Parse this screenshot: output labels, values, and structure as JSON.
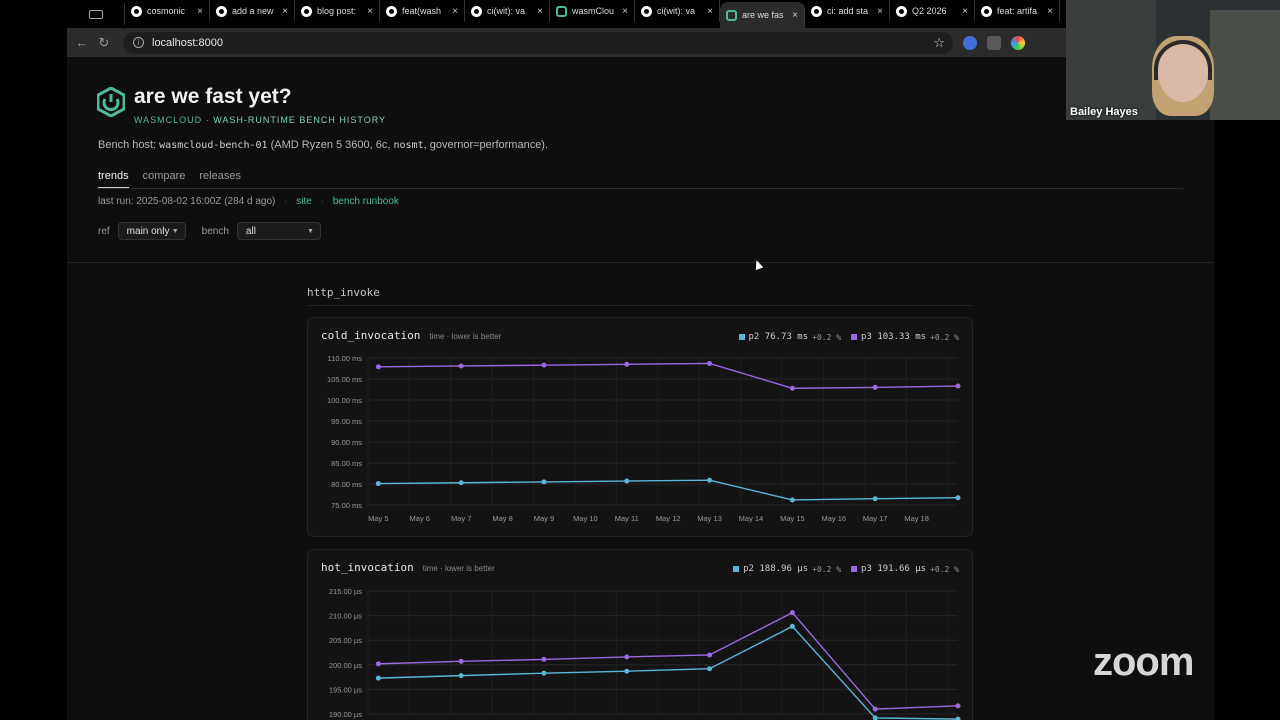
{
  "browser": {
    "tabs": [
      {
        "title": "cosmonic",
        "icon": "github-icon"
      },
      {
        "title": "add a new",
        "icon": "github-icon"
      },
      {
        "title": "blog post:",
        "icon": "github-icon"
      },
      {
        "title": "feat(wash",
        "icon": "github-icon"
      },
      {
        "title": "ci(wit): va",
        "icon": "github-icon"
      },
      {
        "title": "wasmClou",
        "icon": "wasmcloud-icon"
      },
      {
        "title": "ci(wit): va",
        "icon": "github-icon"
      },
      {
        "title": "are we fas",
        "icon": "wasmcloud-icon",
        "active": true
      },
      {
        "title": "ci: add sta",
        "icon": "github-icon"
      },
      {
        "title": "Q2 2026",
        "icon": "github-icon"
      },
      {
        "title": "feat: artifa",
        "icon": "github-icon"
      }
    ],
    "url": "localhost:8000"
  },
  "header": {
    "title": "are we fast yet?",
    "brand": "WASMCLOUD",
    "tagline": "WASH-RUNTIME BENCH HISTORY",
    "host_prefix": "Bench host:",
    "host_name": "wasmcloud-bench-01",
    "host_detail_1": "(AMD Ryzen 5 3600, 6c,",
    "host_smt": "nosmt",
    "host_detail_2": ", governor=performance)."
  },
  "nav": {
    "trends": "trends",
    "compare": "compare",
    "releases": "releases"
  },
  "run": {
    "last_run": "last run: 2025-08-02 16:00Z (284 d ago)",
    "site": "site",
    "runbook": "bench runbook"
  },
  "filters": {
    "ref_label": "ref",
    "ref_value": "main only",
    "bench_label": "bench",
    "bench_value": "all"
  },
  "section": {
    "title": "http_invoke"
  },
  "colors": {
    "p2": "#5ab8d6",
    "p3": "#9b6ae0",
    "accent": "#4dbb9b"
  },
  "cards": [
    {
      "title": "cold_invocation",
      "subtitle": "time · lower is better",
      "legend": [
        {
          "name": "p2",
          "value": "76.73 ms",
          "delta": "+0.2 %"
        },
        {
          "name": "p3",
          "value": "103.33 ms",
          "delta": "+0.2 %"
        }
      ]
    },
    {
      "title": "hot_invocation",
      "subtitle": "time · lower is better",
      "legend": [
        {
          "name": "p2",
          "value": "188.96 µs",
          "delta": "+0.2 %"
        },
        {
          "name": "p3",
          "value": "191.66 µs",
          "delta": "+0.2 %"
        }
      ]
    }
  ],
  "chart_data": [
    {
      "type": "line",
      "title": "cold_invocation",
      "x": [
        "May 5",
        "May 6",
        "May 7",
        "May 8",
        "May 9",
        "May 10",
        "May 11",
        "May 12",
        "May 13",
        "May 14",
        "May 15",
        "May 16",
        "May 17",
        "May 18"
      ],
      "yticks": [
        "110.00 ms",
        "105.00 ms",
        "100.00 ms",
        "95.00 ms",
        "90.00 ms",
        "85.00 ms",
        "80.00 ms",
        "75.00 ms"
      ],
      "ylim": [
        75,
        110
      ],
      "series": [
        {
          "name": "p2",
          "points": [
            [
              "May 5",
              80.1
            ],
            [
              "May 7",
              80.3
            ],
            [
              "May 9",
              80.5
            ],
            [
              "May 11",
              80.7
            ],
            [
              "May 13",
              80.9
            ],
            [
              "May 15",
              76.2
            ],
            [
              "May 17",
              76.5
            ],
            [
              "May 19",
              76.73
            ]
          ]
        },
        {
          "name": "p3",
          "points": [
            [
              "May 5",
              107.9
            ],
            [
              "May 7",
              108.1
            ],
            [
              "May 9",
              108.3
            ],
            [
              "May 11",
              108.5
            ],
            [
              "May 13",
              108.7
            ],
            [
              "May 15",
              102.8
            ],
            [
              "May 17",
              103.0
            ],
            [
              "May 19",
              103.33
            ]
          ]
        }
      ]
    },
    {
      "type": "line",
      "title": "hot_invocation",
      "yticks": [
        "215.00 µs",
        "210.00 µs",
        "205.00 µs",
        "200.00 µs",
        "195.00 µs",
        "190.00 µs"
      ],
      "ylim": [
        190,
        215
      ],
      "series": [
        {
          "name": "p2",
          "points": [
            [
              "May 5",
              197.3
            ],
            [
              "May 7",
              197.8
            ],
            [
              "May 9",
              198.3
            ],
            [
              "May 11",
              198.7
            ],
            [
              "May 13",
              199.2
            ],
            [
              "May 15",
              207.8
            ],
            [
              "May 17",
              189.2
            ],
            [
              "May 19",
              188.96
            ]
          ]
        },
        {
          "name": "p3",
          "points": [
            [
              "May 5",
              200.2
            ],
            [
              "May 7",
              200.7
            ],
            [
              "May 9",
              201.1
            ],
            [
              "May 11",
              201.6
            ],
            [
              "May 13",
              202.0
            ],
            [
              "May 15",
              210.6
            ],
            [
              "May 17",
              191.0
            ],
            [
              "May 19",
              191.66
            ]
          ]
        }
      ]
    }
  ],
  "overlay": {
    "participant": "Bailey Hayes",
    "zoom": "zoom"
  }
}
